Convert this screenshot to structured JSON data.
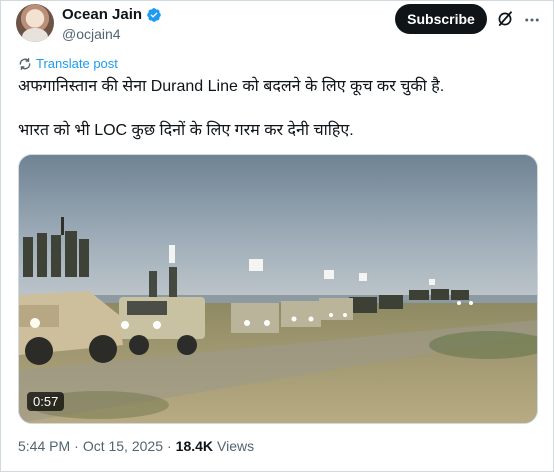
{
  "author": {
    "name": "Ocean Jain",
    "handle": "@ocjain4"
  },
  "header": {
    "subscribe_label": "Subscribe",
    "icons": [
      "grok-icon",
      "more-icon"
    ]
  },
  "tweet": {
    "translate_label": "Translate post",
    "line1": "अफगानिस्तान की सेना Durand Line को बदलने के लिए कूच कर चुकी है.",
    "line2": "भारत को भी LOC कुछ दिनों के लिए गरम कर देनी चाहिए."
  },
  "video": {
    "duration": "0:57"
  },
  "meta": {
    "time": "5:44 PM",
    "separator": "·",
    "date": "Oct 15, 2025",
    "views_count": "18.4K",
    "views_label": "Views"
  },
  "colors": {
    "verified": "#1d9bf0",
    "link": "#1d9bf0",
    "text": "#0f1419",
    "secondary": "#536471"
  }
}
